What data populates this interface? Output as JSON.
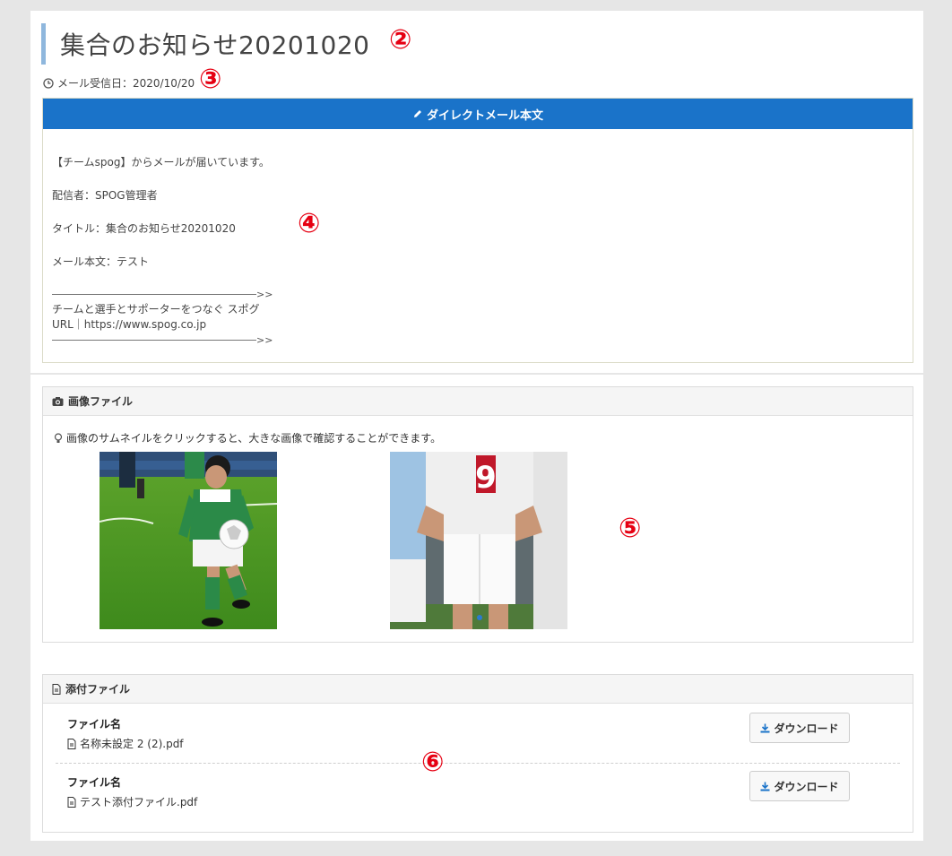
{
  "page": {
    "title": "集合のお知らせ20201020",
    "received_label": "メール受信日：2020/10/20"
  },
  "annotations": [
    "②",
    "③",
    "④",
    "⑤",
    "⑥"
  ],
  "dm": {
    "header": "ダイレクトメール本文",
    "intro": "【チームspog】からメールが届いています。",
    "sender": "配信者：SPOG管理者",
    "subject": "タイトル：集合のお知らせ20201020",
    "body": "メール本文：テスト",
    "arrow": ">>",
    "tagline": "チームと選手とサポーターをつなぐ スポグ",
    "url": "URL｜https://www.spog.co.jp"
  },
  "images": {
    "header": "画像ファイル",
    "hint": "画像のサムネイルをクリックすると、大きな画像で確認することができます。"
  },
  "attachments": {
    "header": "添付ファイル",
    "files": [
      {
        "label": "ファイル名",
        "name": "名称未設定 2 (2).pdf",
        "button": "ダウンロード"
      },
      {
        "label": "ファイル名",
        "name": "テスト添付ファイル.pdf",
        "button": "ダウンロード"
      }
    ]
  },
  "colors": {
    "accent": "#1a73c9",
    "annotation": "#e60012",
    "title_bar": "#8fb7dd"
  }
}
